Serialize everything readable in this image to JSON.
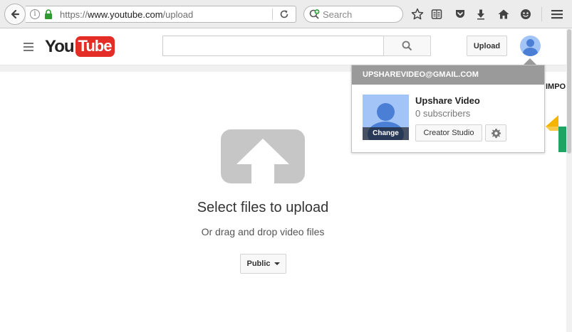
{
  "browser": {
    "url_scheme": "https://",
    "url_host": "www.youtube.com",
    "url_path": "/upload",
    "search_placeholder": "Search",
    "icons": [
      "back-icon",
      "info-icon",
      "lock-icon",
      "reload-icon",
      "search-engine-icon",
      "bookmark-star-icon",
      "reading-list-icon",
      "pocket-icon",
      "download-icon",
      "home-icon",
      "hello-icon",
      "menu-icon"
    ]
  },
  "header": {
    "logo_you": "You",
    "logo_tube": "Tube",
    "search_value": "",
    "upload_label": "Upload"
  },
  "upload": {
    "title": "Select files to upload",
    "subtitle": "Or drag and drop video files",
    "privacy_label": "Public"
  },
  "account_menu": {
    "email": "UPSHAREVIDEO@GMAIL.COM",
    "change_label": "Change",
    "channel_name": "Upshare Video",
    "subscribers": "0 subscribers",
    "creator_studio_label": "Creator Studio"
  },
  "peek": {
    "text": "IMPO"
  },
  "colors": {
    "brand_red": "#e52d27",
    "avatar_bg": "#a3c4f7",
    "avatar_fg": "#4a7fd5",
    "menu_header": "#9a9a9a"
  }
}
